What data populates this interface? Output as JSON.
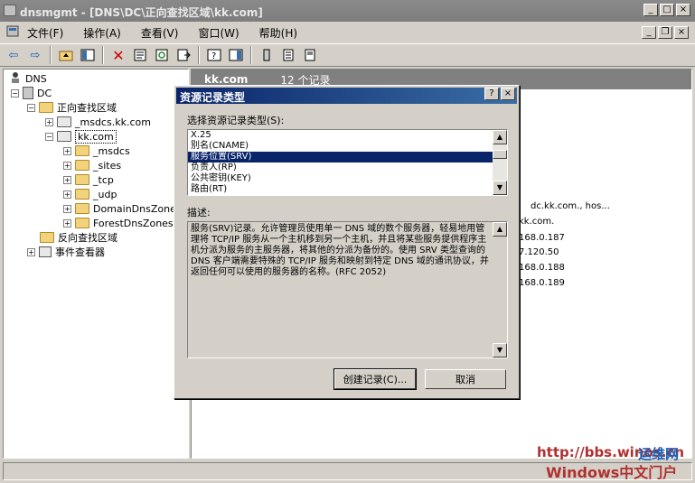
{
  "window": {
    "title": "dnsmgmt - [DNS\\DC\\正向查找区域\\kk.com]"
  },
  "menu": [
    "文件(F)",
    "操作(A)",
    "查看(V)",
    "窗口(W)",
    "帮助(H)"
  ],
  "tree": {
    "root": "DNS",
    "server": "DC",
    "forward_zones": "正向查找区域",
    "msdcs_zone": "_msdcs.kk.com",
    "kk_zone": "kk.com",
    "children": [
      "_msdcs",
      "_sites",
      "_tcp",
      "_udp",
      "DomainDnsZones",
      "ForestDnsZones"
    ],
    "reverse_zones": "反向查找区域",
    "event_viewer": "事件查看器"
  },
  "right_pane": {
    "zone_name": "kk.com",
    "record_count": "12 个记录",
    "cells": [
      "dc.kk.com., hos...",
      "kk.com.",
      "168.0.187",
      "7.120.50",
      "168.0.188",
      "168.0.189"
    ]
  },
  "dialog": {
    "title": "资源记录类型",
    "help_btn": "?",
    "close_btn": "×",
    "select_label": "选择资源记录类型(S):",
    "items": [
      "X.25",
      "别名(CNAME)",
      "服务位置(SRV)",
      "负责人(RP)",
      "公共密钥(KEY)",
      "路由(RT)"
    ],
    "selected_index": 2,
    "desc_label": "描述:",
    "description": "服务(SRV)记录。允许管理员使用单一 DNS 域的数个服务器，轻易地用管理将 TCP/IP 服务从一个主机移到另一个主机，并且将某些服务提供程序主机分派为服务的主服务器，将其他的分派为备份的。使用 SRV 类型查询的 DNS 客户端需要特殊的 TCP/IP 服务和映射到特定 DNS 域的通讯协议，并返回任何可以使用的服务器的名称。(RFC 2052)",
    "create_btn": "创建记录(C)...",
    "cancel_btn": "取消"
  },
  "watermark": {
    "url": "http://bbs.winos.cn",
    "site": "Windows中文门户",
    "brand": "运维网"
  }
}
